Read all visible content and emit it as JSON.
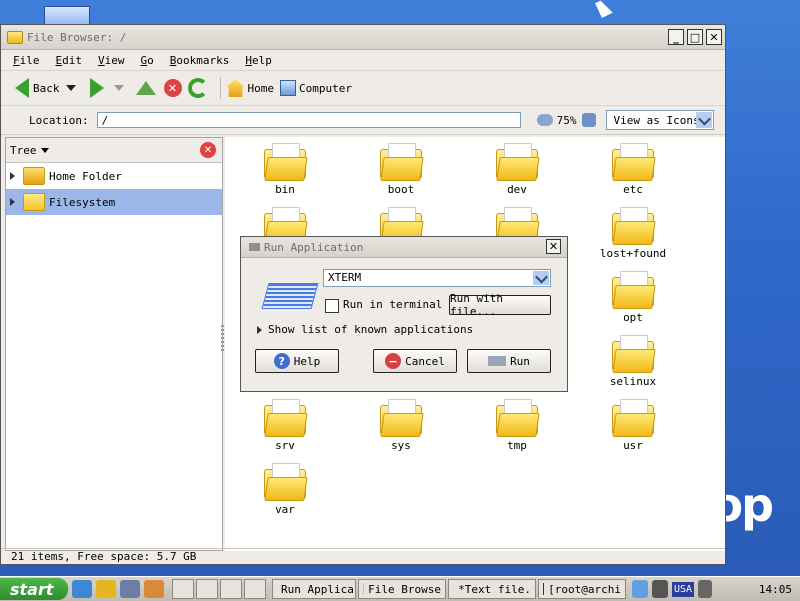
{
  "window": {
    "title": "File Browser: /"
  },
  "menu": [
    "File",
    "Edit",
    "View",
    "Go",
    "Bookmarks",
    "Help"
  ],
  "toolbar": {
    "back_label": "Back",
    "home_label": "Home",
    "computer_label": "Computer"
  },
  "location": {
    "label": "Location:",
    "value": "/",
    "zoom": "75%",
    "view_mode": "View as Icons"
  },
  "sidepane": {
    "title": "Tree",
    "items": [
      {
        "label": "Home Folder"
      },
      {
        "label": "Filesystem"
      }
    ]
  },
  "folders": [
    "bin",
    "boot",
    "dev",
    "etc",
    "lost+found",
    "opt",
    "selinux",
    "srv",
    "sys",
    "tmp",
    "usr",
    "var"
  ],
  "status": "21 items, Free space: 5.7 GB",
  "dialog": {
    "title": "Run Application",
    "command": "XTERM",
    "run_in_terminal": "Run in terminal",
    "run_with_file": "Run with file...",
    "show_list": "Show list of known applications",
    "help": "Help",
    "cancel": "Cancel",
    "run": "Run"
  },
  "desktop": {
    "bg_text": "op"
  },
  "taskbar": {
    "start": "start",
    "tasks": [
      "Run Applica",
      "File Browse",
      "*Text file.",
      "[root@archi"
    ],
    "layout": "USA",
    "clock": "14:05"
  },
  "colors": {
    "selection": "#9bb7ea",
    "desktop": "#2f68c8",
    "start_green": "#3a9e3a"
  }
}
